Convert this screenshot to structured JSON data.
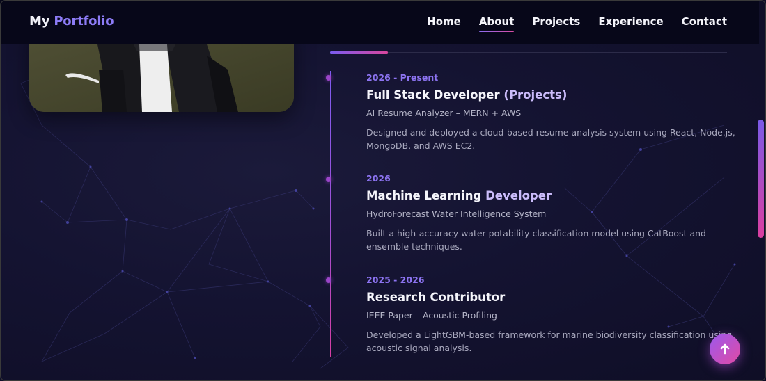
{
  "brand": {
    "part1": "My ",
    "part2": "Portfolio"
  },
  "nav": {
    "items": [
      {
        "label": "Home",
        "active": false
      },
      {
        "label": "About",
        "active": true
      },
      {
        "label": "Projects",
        "active": false
      },
      {
        "label": "Experience",
        "active": false
      },
      {
        "label": "Contact",
        "active": false
      }
    ]
  },
  "timeline": [
    {
      "date": "2026 - Present",
      "role_main": "Full Stack Developer ",
      "role_highlight": "(Projects)",
      "subtitle": "AI Resume Analyzer – MERN + AWS",
      "description": "Designed and deployed a cloud-based resume analysis system using React, Node.js, MongoDB, and AWS EC2."
    },
    {
      "date": "2026",
      "role_main": "Machine Learning ",
      "role_highlight": "Developer",
      "subtitle": "HydroForecast Water Intelligence System",
      "description": "Built a high-accuracy water potability classification model using CatBoost and ensemble techniques."
    },
    {
      "date": "2025 - 2026",
      "role_main": "Research Contributor",
      "role_highlight": "",
      "subtitle": "IEEE Paper – Acoustic Profiling",
      "description": "Developed a LightGBM-based framework for marine biodiversity classification using acoustic signal analysis."
    }
  ],
  "icons": {
    "back_to_top": "arrow-up-icon"
  },
  "colors": {
    "accent_purple": "#8d74f2",
    "accent_pink": "#d9469e",
    "background": "#141331",
    "nav_bg": "#070719"
  }
}
